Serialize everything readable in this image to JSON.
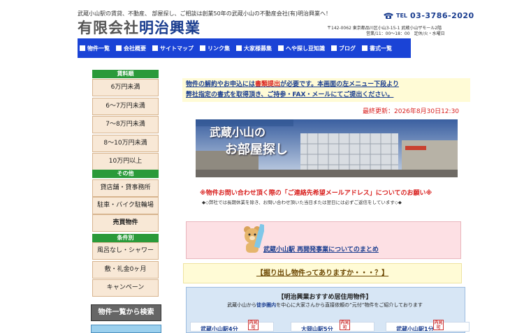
{
  "header": {
    "tagline": "武蔵小山駅の賃貸、不動産、 部屋探し、ご相談は創業50年の武蔵小山の不動産会社(有)明治興業へ！",
    "logo_prefix": "有限会社",
    "logo_name": "明治興業",
    "tel_label": "TEL",
    "tel_number": "03-3786-2020",
    "address": "〒142-0062 東京都品川区小山3-15-1 武蔵小山ザモール2階",
    "hours": "営業/11：00～18：00　定休/火・水曜日"
  },
  "nav": {
    "items": [
      "物件一覧",
      "会社概要",
      "サイトマップ",
      "リンク集",
      "大家様募集",
      "へや探し豆知識",
      "ブログ",
      "書式一覧"
    ]
  },
  "sidebar": {
    "price_heading": "賃料順",
    "price_items": [
      "6万円未満",
      "6～7万円未満",
      "7～8万円未満",
      "8～10万円未満",
      "10万円以上"
    ],
    "other_heading": "その他",
    "other_items": [
      "貸店舗・貸事務所",
      "駐車・バイク駐輪場",
      "売買物件"
    ],
    "cond_heading": "条件別",
    "cond_items": [
      "風呂なし・シャワー",
      "敷・礼金0ヶ月",
      "キャンペーン"
    ],
    "banner": "物件一覧から検索"
  },
  "main": {
    "notice_line1_a": "物件の解約やお申込には",
    "notice_line1_red": "書類提出",
    "notice_line1_b": "が必要です。本画面の左メニュー下段より",
    "notice_line2": "弊社指定の書式を取得頂き、ご持参・FAX・メールにてご提出ください。",
    "updated": "最終更新：2026年8月30日12:30",
    "hero_line1": "武蔵小山の",
    "hero_line2": "お部屋探し",
    "email_notice": "※物件お問い合わせ頂く際の「ご連絡先希望メールアドレス」についてのお願い※",
    "email_sub": "◆◇弊社では長期休業を除き、お問い合わせ頂いた当日または翌日には必ずご返信をしています◇◆",
    "redev_link": "武蔵小山駅 再開発事業についてのまとめ",
    "dig_link": "【掘り出し物件ってありますか・・・？】",
    "reco_title": "【明治興業おすすめ居住用物件】",
    "reco_sub_a": "武蔵小山から",
    "reco_sub_hl": "徒歩圏内",
    "reco_sub_b": "を中心に大家さんから直接依頼の”元付”物件をご紹介しております",
    "cards": [
      "武蔵小山駅4分",
      "大岡山駅5分",
      "武蔵小山駅1分"
    ],
    "card_badge": "内見可"
  },
  "colors": {
    "nav_blue": "#1a43d6",
    "sidebar_green": "#2a9a3a",
    "sidebar_button_bg": "#f8e8d6",
    "accent_red": "#d9211f",
    "link_blue": "#1a3d8f"
  }
}
